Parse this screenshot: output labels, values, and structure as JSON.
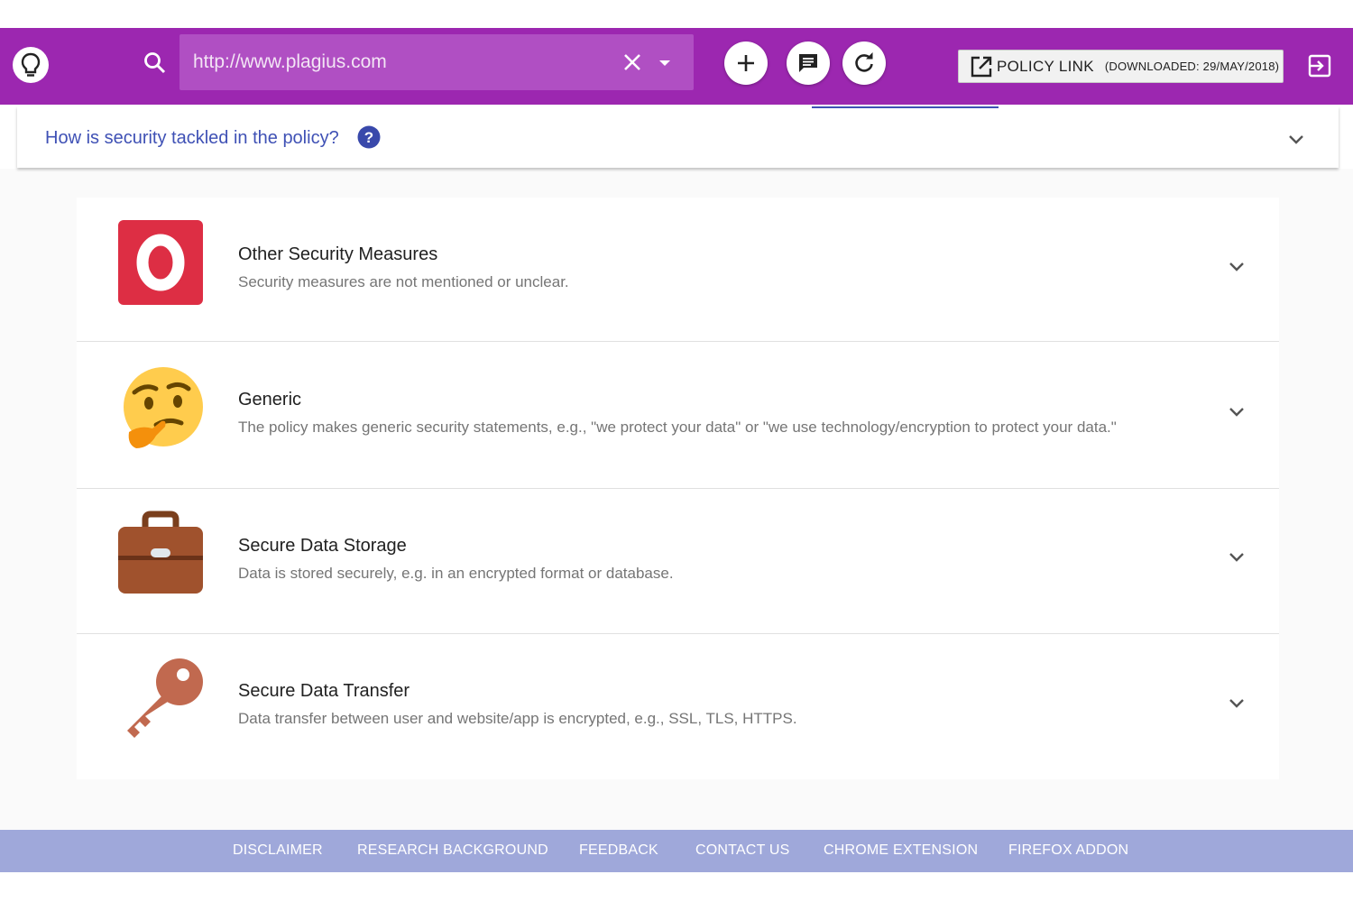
{
  "toolbar": {
    "url_value": "http://www.plagius.com",
    "policy_link_label": "POLICY LINK",
    "policy_link_date": "(DOWNLOADED: 29/MAY/2018)",
    "background_color": "#9c27b0",
    "icons": {
      "logo": "lightbulb-icon",
      "search": "search-icon",
      "clear": "close-icon",
      "dropdown": "arrow-drop-down-icon",
      "add": "add-icon",
      "comment": "comment-icon",
      "refresh": "refresh-icon",
      "open_external": "open-in-new-icon",
      "logout": "exit-icon"
    }
  },
  "question": {
    "text": "How is security tackled in the policy?",
    "color": "#3f51b5"
  },
  "items": [
    {
      "title": "Other Security Measures",
      "description": "Security measures are not mentioned or unclear.",
      "icon": "o-letter-icon"
    },
    {
      "title": "Generic",
      "description": "The policy makes generic security statements, e.g., \"we protect your data\" or \"we use technology/encryption to protect your data.\"",
      "icon": "thinking-face-icon"
    },
    {
      "title": "Secure Data Storage",
      "description": "Data is stored securely, e.g. in an encrypted format or database.",
      "icon": "briefcase-icon"
    },
    {
      "title": "Secure Data Transfer",
      "description": "Data transfer between user and website/app is encrypted, e.g., SSL, TLS, HTTPS.",
      "icon": "key-icon"
    }
  ],
  "footer": {
    "links": [
      "DISCLAIMER",
      "RESEARCH BACKGROUND",
      "FEEDBACK",
      "CONTACT US",
      "CHROME EXTENSION",
      "FIREFOX ADDON"
    ],
    "background_color": "#9fa8da"
  }
}
